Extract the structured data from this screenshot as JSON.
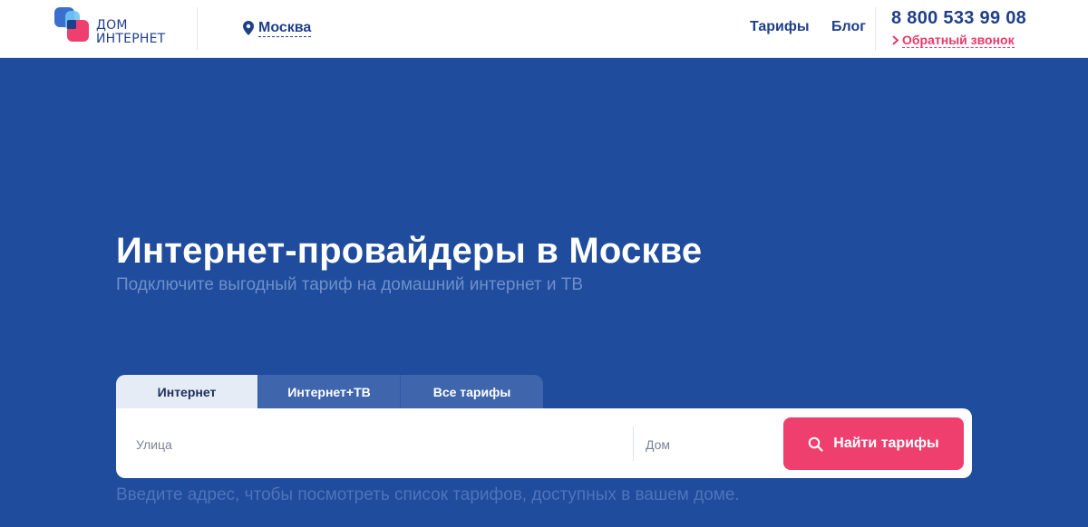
{
  "header": {
    "logo": {
      "line1": "ДОМ",
      "line2": "ИНТЕРНЕТ"
    },
    "city": {
      "icon": "location-pin-icon",
      "name": "Москва"
    },
    "nav": [
      {
        "label": "Тарифы"
      },
      {
        "label": "Блог"
      }
    ],
    "phone": "8 800 533 99 08",
    "callback": {
      "icon": "chevron-right-icon",
      "label": "Обратный звонок"
    }
  },
  "hero": {
    "title": "Интернет-провайдеры в Москве",
    "subtitle": "Подключите выгодный тариф на домашний интернет и ТВ"
  },
  "search": {
    "tabs": [
      {
        "label": "Интернет",
        "active": true
      },
      {
        "label": "Интернет+ТВ",
        "active": false
      },
      {
        "label": "Все тарифы",
        "active": false
      }
    ],
    "street_placeholder": "Улица",
    "house_placeholder": "Дом",
    "button_label": "Найти тарифы",
    "button_icon": "search-icon",
    "hint": "Введите адрес, чтобы посмотреть список тарифов, доступных в вашем доме."
  },
  "colors": {
    "hero_bg": "#1f4c9c",
    "brand_blue": "#1f3f8a",
    "accent_pink": "#ef3f6e",
    "tab_inactive": "#3f65ad",
    "tab_active": "#e6ecf6"
  }
}
